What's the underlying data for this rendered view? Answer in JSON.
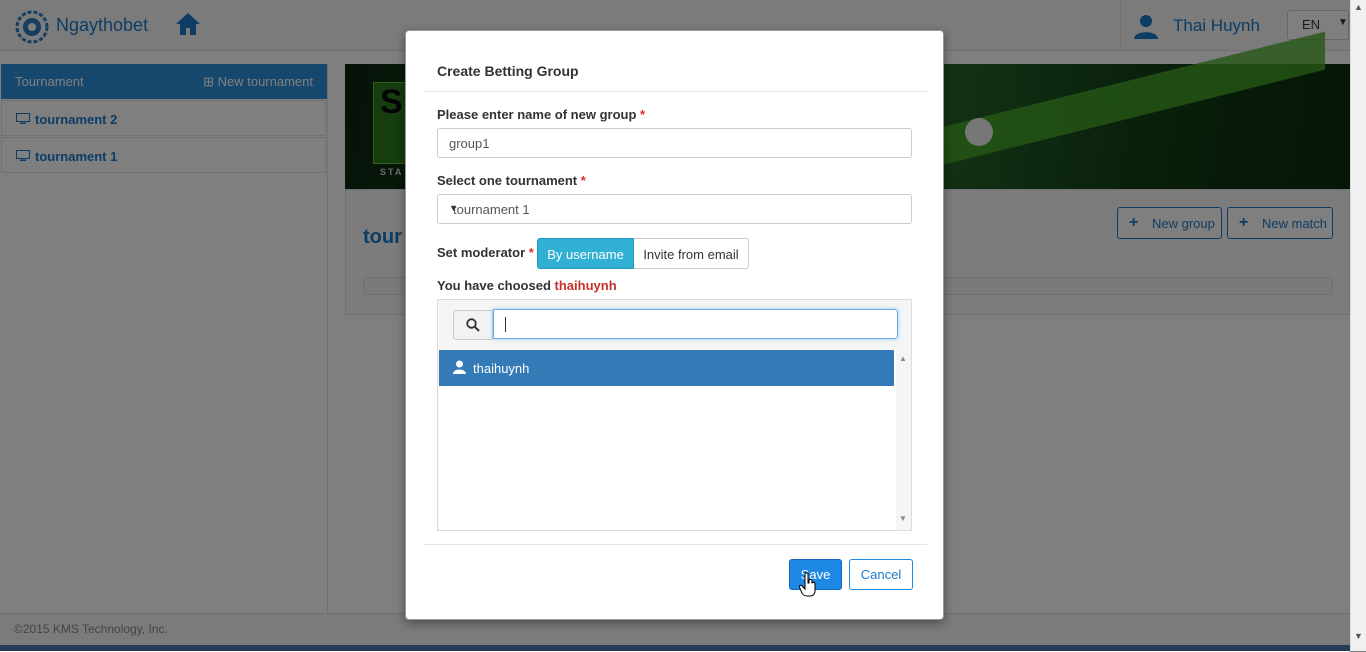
{
  "header": {
    "brand": "Ngaythobet",
    "user_name": "Thai Huynh",
    "language": "EN"
  },
  "sidebar": {
    "title": "Tournament",
    "new_tournament_label": "New tournament",
    "items": [
      {
        "label": "tournament 2"
      },
      {
        "label": "tournament 1"
      }
    ]
  },
  "main": {
    "title_partial": "tour",
    "banner_text": "S",
    "banner_small": "STA",
    "new_group_label": "New group",
    "new_match_label": "New match"
  },
  "footer": {
    "copyright": "©2015 KMS Technology, Inc."
  },
  "modal": {
    "title": "Create Betting Group",
    "group_name_label": "Please enter name of new group",
    "group_name_value": "group1",
    "tournament_label": "Select one tournament",
    "tournament_value": "tournament 1",
    "moderator_label": "Set moderator",
    "by_username_label": "By username",
    "invite_email_label": "Invite from email",
    "chosen_prefix": "You have choosed",
    "chosen_user": "thaihuynh",
    "search_value": "",
    "results": [
      {
        "username": "thaihuynh"
      }
    ],
    "save_label": "Save",
    "cancel_label": "Cancel"
  },
  "colors": {
    "primary": "#1a79c9",
    "sidebar_header": "#2a90d9",
    "toggle_active": "#31b0d5",
    "selected_item": "#337ab7",
    "required": "#d9302c"
  }
}
